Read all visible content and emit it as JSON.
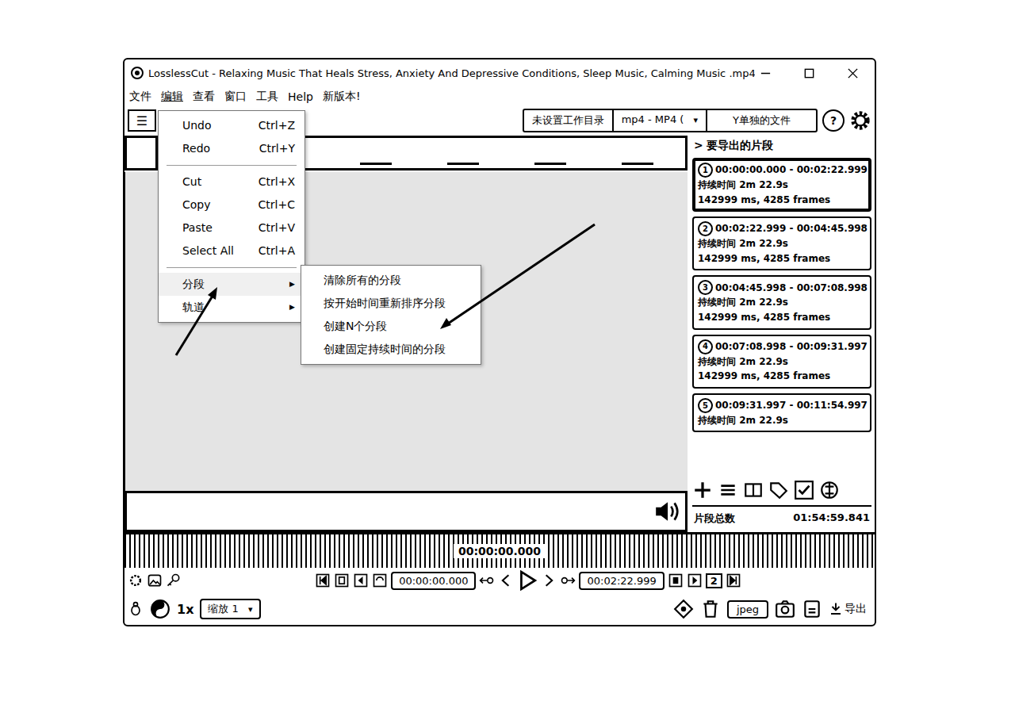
{
  "window": {
    "title": "LosslessCut - Relaxing Music That Heals Stress, Anxiety And Depressive Conditions, Sleep Music, Calming Music .mp4"
  },
  "menu_bar": [
    {
      "label": "文件",
      "selected": false
    },
    {
      "label": "编辑",
      "selected": true
    },
    {
      "label": "查看",
      "selected": false
    },
    {
      "label": "窗口",
      "selected": false
    },
    {
      "label": "工具",
      "selected": false
    },
    {
      "label": "Help",
      "selected": false
    },
    {
      "label": "新版本!",
      "selected": false
    }
  ],
  "edit_menu": [
    {
      "kind": "item",
      "label": "Undo",
      "shortcut": "Ctrl+Z"
    },
    {
      "kind": "item",
      "label": "Redo",
      "shortcut": "Ctrl+Y"
    },
    {
      "kind": "separator"
    },
    {
      "kind": "item",
      "label": "Cut",
      "shortcut": "Ctrl+X"
    },
    {
      "kind": "item",
      "label": "Copy",
      "shortcut": "Ctrl+C"
    },
    {
      "kind": "item",
      "label": "Paste",
      "shortcut": "Ctrl+V"
    },
    {
      "kind": "item",
      "label": "Select All",
      "shortcut": "Ctrl+A"
    },
    {
      "kind": "separator"
    },
    {
      "kind": "submenu",
      "label": "分段",
      "arrow": "▶",
      "expanded": true
    },
    {
      "kind": "submenu",
      "label": "轨道",
      "arrow": "▶",
      "expanded": false
    }
  ],
  "segment_submenu": [
    "清除所有的分段",
    "按开始时间重新排序分段",
    "创建N个分段",
    "创建固定持续时间的分段"
  ],
  "toolbar": {
    "menu_button": "☰",
    "working_dir": "未设置工作目录",
    "format": "mp4 - MP4 (",
    "format_arrow": "▾",
    "output_icon": "Y",
    "output_mode": "单独的文件",
    "help": "?"
  },
  "segments_panel": {
    "toggle": ">",
    "title": "要导出的片段",
    "segments": [
      {
        "number": "1",
        "time_range": "00:00:00.000 - 00:02:22.999",
        "duration": "持续时间 2m 22.9s",
        "detail": "142999 ms, 4285 frames",
        "selected": true
      },
      {
        "number": "2",
        "time_range": "00:02:22.999 - 00:04:45.998",
        "duration": "持续时间 2m 22.9s",
        "detail": "142999 ms, 4285 frames",
        "selected": false
      },
      {
        "number": "3",
        "time_range": "00:04:45.998 - 00:07:08.998",
        "duration": "持续时间 2m 22.9s",
        "detail": "142999 ms, 4285 frames",
        "selected": false
      },
      {
        "number": "4",
        "time_range": "00:07:08.998 - 00:09:31.997",
        "duration": "持续时间 2m 22.9s",
        "detail": "142999 ms, 4285 frames",
        "selected": false
      },
      {
        "number": "5",
        "time_range": "00:09:31.997 - 00:11:54.997",
        "duration": "持续时间 2m 22.9s",
        "selected": false
      }
    ],
    "total_label": "片段总数",
    "total_value": "01:54:59.841"
  },
  "timeline": {
    "current_time": "00:00:00.000"
  },
  "controls": {
    "start_time": "00:00:00.000",
    "end_time": "00:02:22.999",
    "segment_badge": "2"
  },
  "bottom_bar": {
    "speed": "1x",
    "zoom": "缩放 1",
    "zoom_arrow": "▾",
    "capture_format": "jpeg",
    "export": "导出"
  }
}
